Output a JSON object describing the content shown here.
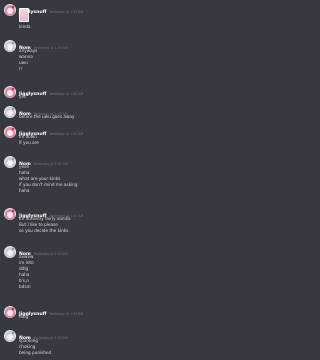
{
  "messages": [
    {
      "author": "Jigglysnuff",
      "time": "Yesterday at 1:21 AM",
      "avatar": "pink-anime-avatar",
      "lines": [
        "kinda"
      ],
      "sticker": true
    },
    {
      "author": "Nom",
      "time": "Yesterday at 1:39 AM",
      "avatar": "white-anime-avatar",
      "lines": [
        "anyways",
        "wanna",
        "uwu",
        "rr"
      ]
    },
    {
      "author": "Jigglysnuff",
      "time": "Yesterday at 1:40 AM",
      "avatar": "pink-anime-avatar",
      "lines": [
        "yes"
      ]
    },
    {
      "author": "Nom",
      "time": "Yesterday at 1:40 AM",
      "avatar": "white-anime-avatar",
      "lines": [
        "before the uwu goes away"
      ]
    },
    {
      "author": "Jigglysnuff",
      "time": "Yesterday at 1:41 AM",
      "avatar": "pink-anime-avatar",
      "lines": [
        "Im down",
        "If you are"
      ]
    },
    {
      "author": "Nom",
      "time": "Yesterday at 1:41 AM",
      "avatar": "white-anime-avatar",
      "lines": [
        "yeah",
        "haha",
        "what are your kinks",
        "if you don't mind me asking",
        "haha"
      ]
    },
    {
      "author": "Jigglysnuff",
      "time": "Yesterday at 1:42 AM",
      "avatar": "pink-anime-avatar",
      "lines": [
        "Im honestly fairly vanilla",
        "But I like to please",
        "so you decide the kinks"
      ]
    },
    {
      "author": "Nom",
      "time": "Yesterday at 1:43 AM",
      "avatar": "white-anime-avatar",
      "lines": [
        "avwvw",
        "im into",
        "ddlg",
        "haha",
        "b's,n",
        "bdsm"
      ]
    },
    {
      "author": "Jigglysnuff",
      "time": "Yesterday at 1:43 AM",
      "avatar": "pink-anime-avatar",
      "lines": [
        "ddlg"
      ]
    },
    {
      "author": "Nom",
      "time": "Yesterday at 1:43 AM",
      "avatar": "white-anime-avatar",
      "lines": [
        "spanking",
        "choking",
        "being punished"
      ]
    }
  ]
}
